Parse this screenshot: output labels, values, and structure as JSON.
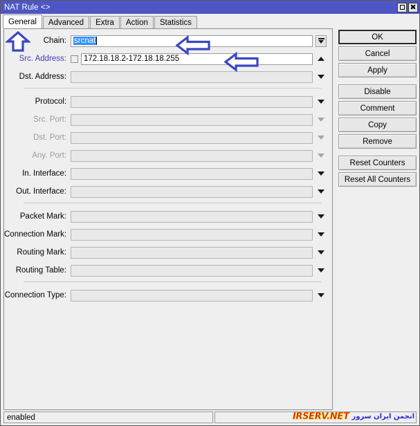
{
  "window": {
    "title": "NAT Rule <>",
    "buttons": {
      "maximize": "maximize-button",
      "close": "close-button"
    }
  },
  "tabs": [
    {
      "label": "General",
      "active": true
    },
    {
      "label": "Advanced",
      "active": false
    },
    {
      "label": "Extra",
      "active": false
    },
    {
      "label": "Action",
      "active": false
    },
    {
      "label": "Statistics",
      "active": false
    }
  ],
  "form": {
    "groups": [
      {
        "rows": [
          {
            "label": "Chain:",
            "value": "srcnat",
            "selected": true,
            "style": "normal",
            "field": "white",
            "checkbox": false,
            "arrow": "combo-boxed"
          },
          {
            "label": "Src. Address:",
            "value": "172.18.18.2-172.18.18.255",
            "selected": false,
            "style": "blue",
            "field": "white",
            "checkbox": true,
            "arrow": "up"
          },
          {
            "label": "Dst. Address:",
            "value": "",
            "selected": false,
            "style": "normal",
            "field": "disabled",
            "checkbox": false,
            "arrow": "down"
          }
        ]
      },
      {
        "rows": [
          {
            "label": "Protocol:",
            "value": "",
            "style": "normal",
            "field": "disabled",
            "checkbox": false,
            "arrow": "down"
          },
          {
            "label": "Src. Port:",
            "value": "",
            "style": "dim",
            "field": "disabled",
            "checkbox": false,
            "arrow": "down-dim"
          },
          {
            "label": "Dst. Port:",
            "value": "",
            "style": "dim",
            "field": "disabled",
            "checkbox": false,
            "arrow": "down-dim"
          },
          {
            "label": "Any. Port:",
            "value": "",
            "style": "dim",
            "field": "disabled",
            "checkbox": false,
            "arrow": "down-dim"
          },
          {
            "label": "In. Interface:",
            "value": "",
            "style": "normal",
            "field": "disabled",
            "checkbox": false,
            "arrow": "down"
          },
          {
            "label": "Out. Interface:",
            "value": "",
            "style": "normal",
            "field": "disabled",
            "checkbox": false,
            "arrow": "down"
          }
        ]
      },
      {
        "rows": [
          {
            "label": "Packet Mark:",
            "value": "",
            "style": "normal",
            "field": "disabled",
            "checkbox": false,
            "arrow": "down"
          },
          {
            "label": "Connection Mark:",
            "value": "",
            "style": "normal",
            "field": "disabled",
            "checkbox": false,
            "arrow": "down"
          },
          {
            "label": "Routing Mark:",
            "value": "",
            "style": "normal",
            "field": "disabled",
            "checkbox": false,
            "arrow": "down"
          },
          {
            "label": "Routing Table:",
            "value": "",
            "style": "normal",
            "field": "disabled",
            "checkbox": false,
            "arrow": "down"
          }
        ]
      },
      {
        "rows": [
          {
            "label": "Connection Type:",
            "value": "",
            "style": "normal",
            "field": "disabled",
            "checkbox": false,
            "arrow": "down"
          }
        ]
      }
    ]
  },
  "actions": [
    {
      "label": "OK",
      "focus": true,
      "gap_after": false
    },
    {
      "label": "Cancel",
      "focus": false,
      "gap_after": false
    },
    {
      "label": "Apply",
      "focus": false,
      "gap_after": true
    },
    {
      "label": "Disable",
      "focus": false,
      "gap_after": false
    },
    {
      "label": "Comment",
      "focus": false,
      "gap_after": false
    },
    {
      "label": "Copy",
      "focus": false,
      "gap_after": false
    },
    {
      "label": "Remove",
      "focus": false,
      "gap_after": true
    },
    {
      "label": "Reset Counters",
      "focus": false,
      "gap_after": false
    },
    {
      "label": "Reset All Counters",
      "focus": false,
      "gap_after": false
    }
  ],
  "statusbar": {
    "state": "enabled",
    "second": ""
  },
  "watermark": {
    "persian": "انجمن ایران سرور",
    "english": "IRSERV.NET"
  },
  "annotations": [
    {
      "name": "annotation-arrow-up-tab",
      "direction": "up"
    },
    {
      "name": "annotation-arrow-left-chain",
      "direction": "left"
    },
    {
      "name": "annotation-arrow-left-src-address",
      "direction": "left"
    }
  ],
  "colors": {
    "titlebar": "#4d56c4",
    "selection": "#3390ff",
    "annotation": "#3b46c4",
    "label_blue": "#3b3bbd",
    "label_dim": "#9b9b9b",
    "watermark_red": "#e01b12",
    "watermark_yellow": "#f5d400"
  }
}
